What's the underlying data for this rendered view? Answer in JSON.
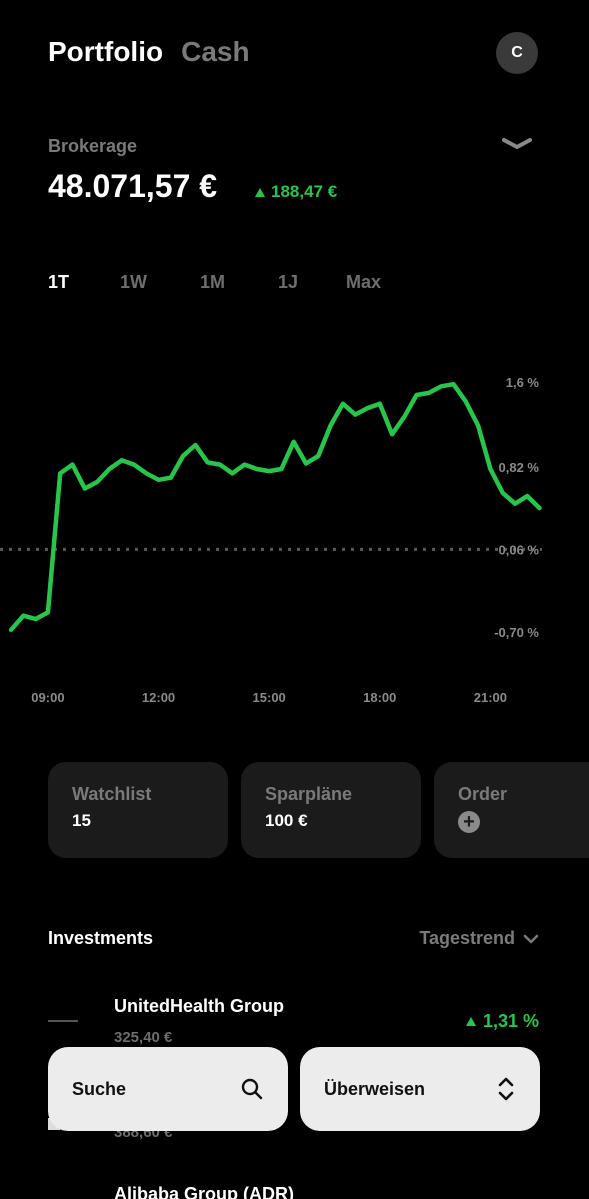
{
  "header": {
    "tab_active": "Portfolio",
    "tab_inactive": "Cash",
    "avatar_initial": "C"
  },
  "account": {
    "label": "Brokerage",
    "balance": "48.071,57 €",
    "change": "188,47 €",
    "change_direction": "up"
  },
  "ranges": [
    "1T",
    "1W",
    "1M",
    "1J",
    "Max"
  ],
  "active_range": "1T",
  "colors": {
    "positive": "#27c64a",
    "background": "#000000",
    "card": "#1b1b1b",
    "muted": "#7a7a7a"
  },
  "chart_data": {
    "type": "line",
    "x": [
      "08:00",
      "08:20",
      "08:40",
      "09:00",
      "09:20",
      "09:40",
      "10:00",
      "10:20",
      "10:40",
      "11:00",
      "11:20",
      "11:40",
      "12:00",
      "12:20",
      "12:40",
      "13:00",
      "13:20",
      "13:40",
      "14:00",
      "14:20",
      "14:40",
      "15:00",
      "15:20",
      "15:40",
      "16:00",
      "16:20",
      "16:40",
      "17:00",
      "17:20",
      "17:40",
      "18:00",
      "18:20",
      "18:40",
      "19:00",
      "19:20",
      "19:40",
      "20:00",
      "20:20",
      "20:40",
      "21:00",
      "21:20",
      "21:40",
      "22:00",
      "22:20"
    ],
    "values": [
      -0.68,
      -0.55,
      -0.58,
      -0.52,
      0.76,
      0.84,
      0.62,
      0.68,
      0.8,
      0.88,
      0.84,
      0.76,
      0.7,
      0.72,
      0.92,
      1.02,
      0.86,
      0.84,
      0.76,
      0.84,
      0.8,
      0.78,
      0.8,
      1.05,
      0.85,
      0.92,
      1.2,
      1.4,
      1.3,
      1.36,
      1.4,
      1.12,
      1.28,
      1.48,
      1.5,
      1.56,
      1.58,
      1.42,
      1.2,
      0.8,
      0.58,
      0.48,
      0.55,
      0.44
    ],
    "ylabel_ticks": [
      "1,6 %",
      "0,82 %",
      "0,06 %",
      "-0,70 %"
    ],
    "xlabel_ticks": [
      "09:00",
      "12:00",
      "15:00",
      "18:00",
      "21:00"
    ],
    "baseline": 0.06,
    "ylim": [
      -0.9,
      1.8
    ],
    "grid": false,
    "series": [
      {
        "values_ref": "values",
        "color": "#27c64a"
      }
    ]
  },
  "cards": [
    {
      "title": "Watchlist",
      "value": "15"
    },
    {
      "title": "Sparpläne",
      "value": "100 €"
    },
    {
      "title": "Order",
      "value": "",
      "icon": "plus-icon"
    }
  ],
  "investments": {
    "title": "Investments",
    "sort_label": "Tagestrend",
    "items": [
      {
        "name": "UnitedHealth Group",
        "price": "325,40 €",
        "trend": "1,31 %",
        "direction": "up"
      },
      {
        "name": "",
        "price": "388,60 €",
        "trend": "",
        "direction": "up"
      },
      {
        "name": "Alibaba Group (ADR)",
        "price": "",
        "trend": "",
        "direction": "up"
      }
    ]
  },
  "bottom_bar": {
    "search_label": "Suche",
    "transfer_label": "Überweisen"
  }
}
